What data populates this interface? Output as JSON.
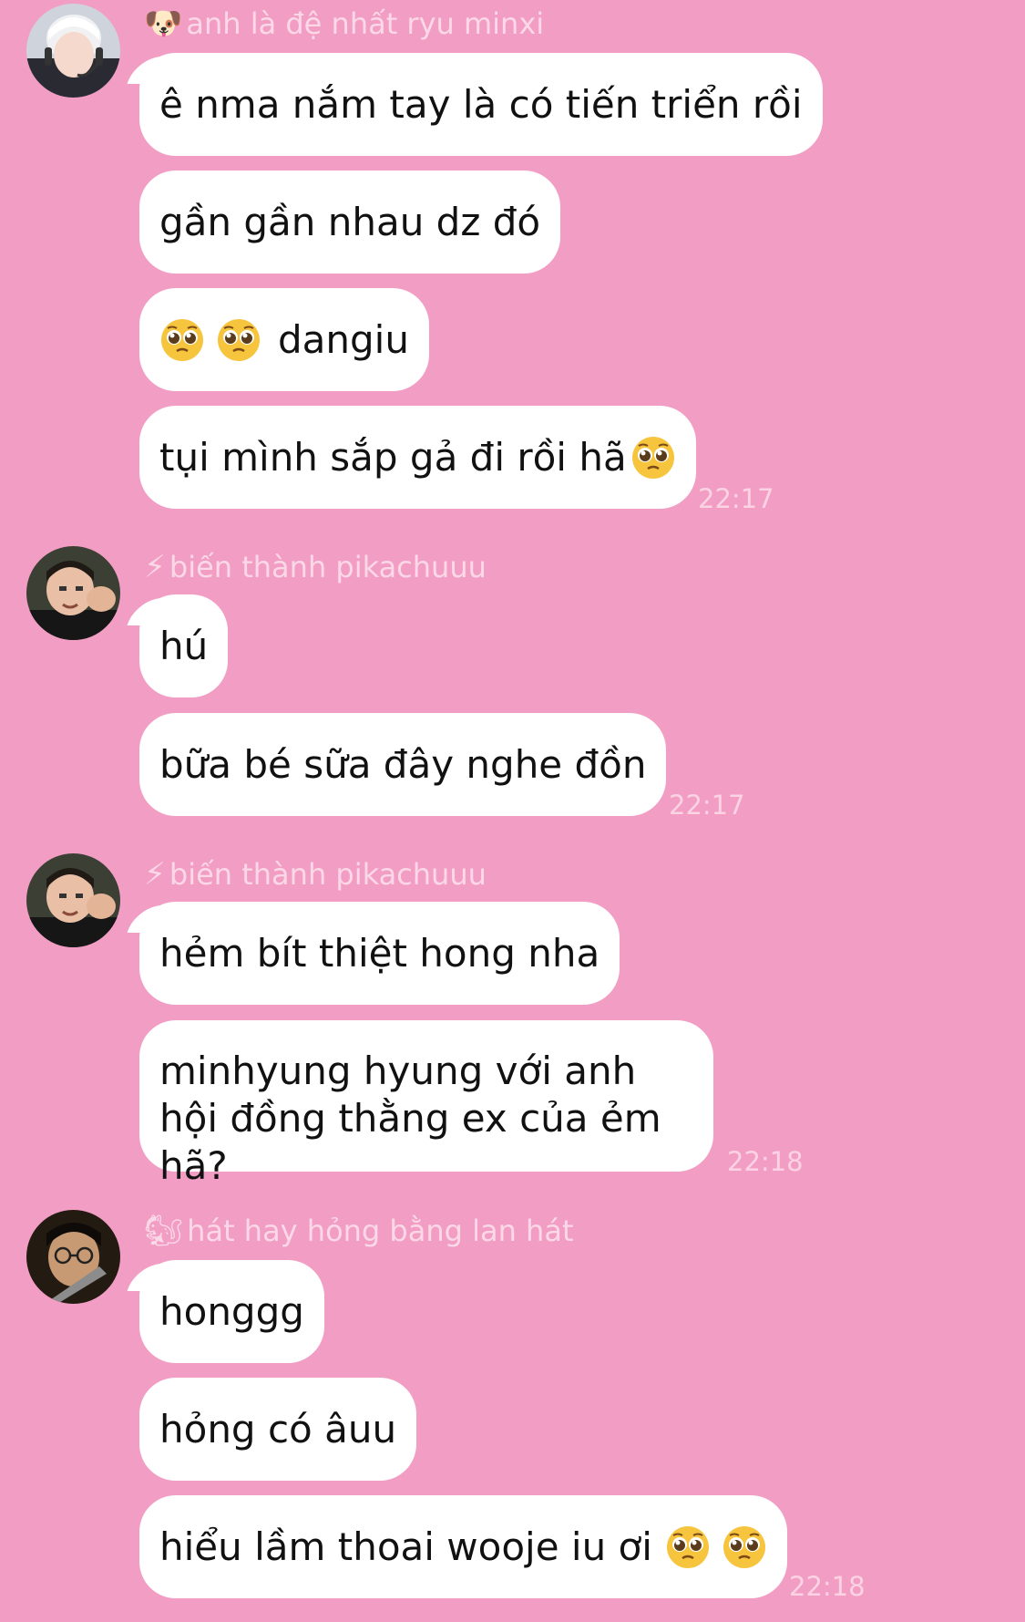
{
  "messages": [
    {
      "sender": "anh là đệ nhất ryu minxi",
      "sender_icon": "dog-face-icon",
      "sender_emoji": "🐶",
      "bubbles": [
        "ê nma nắm tay là có tiến triển rồi",
        "gần gần nhau dz đó",
        "dangiu",
        "tụi mình sắp gả đi rồi hã"
      ],
      "time": "22:17"
    },
    {
      "sender": "biến thành pikachuuu",
      "sender_icon": "lightning-icon",
      "sender_emoji": "⚡",
      "bubbles": [
        "hú",
        "bữa bé sữa đây nghe đồn"
      ],
      "time": "22:17"
    },
    {
      "sender": "biến thành pikachuuu",
      "sender_icon": "lightning-icon",
      "sender_emoji": "⚡",
      "bubbles": [
        "hẻm bít thiệt hong nha",
        "minhyung hyung với anh hội đồng thằng ex của ẻm hã?"
      ],
      "time": "22:18"
    },
    {
      "sender": "hát hay hỏng bằng lan hát",
      "sender_icon": "chipmunk-icon",
      "sender_emoji": "🐿",
      "bubbles": [
        "honggg",
        "hỏng có âuu",
        "hiểu lầm thoai wooje iu ơi"
      ],
      "time": "22:18"
    }
  ],
  "colors": {
    "background": "#f29dc3",
    "bubble": "#ffffff",
    "meta_text": "#fbd8e7"
  },
  "icons": {
    "pleading_face": "pleading-face-icon"
  }
}
